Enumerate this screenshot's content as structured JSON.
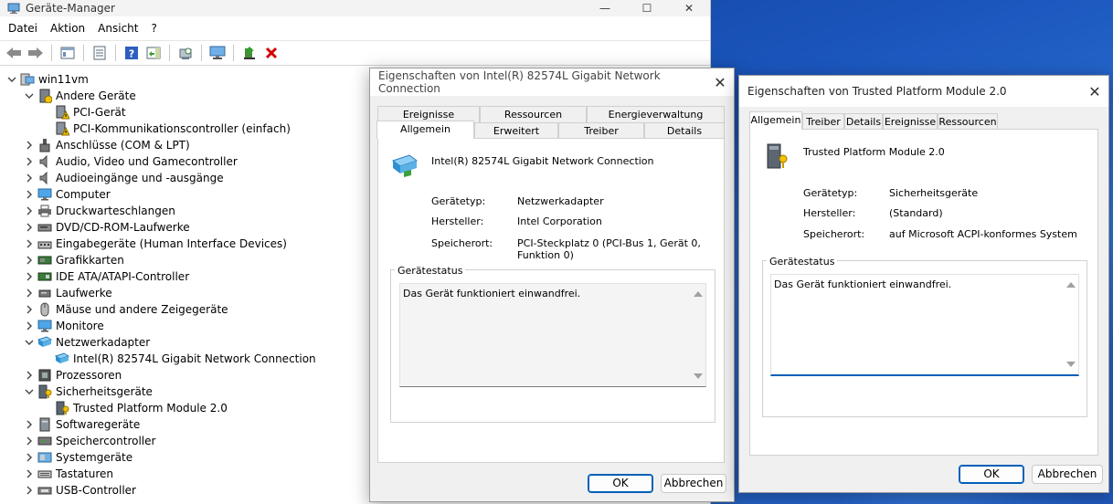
{
  "device_manager": {
    "title": "Geräte-Manager",
    "window_controls": {
      "minimize": "—",
      "maximize": "☐",
      "close": "✕"
    },
    "menu": [
      "Datei",
      "Aktion",
      "Ansicht",
      "?"
    ],
    "tree": [
      {
        "label": "win11vm",
        "level": 0,
        "expand": "v",
        "icon": "computer-icon"
      },
      {
        "label": "Andere Geräte",
        "level": 1,
        "expand": "v",
        "icon": "unknown-device-icon"
      },
      {
        "label": "PCI-Gerät",
        "level": 2,
        "expand": "",
        "icon": "warning-device-icon"
      },
      {
        "label": "PCI-Kommunikationscontroller (einfach)",
        "level": 2,
        "expand": "",
        "icon": "warning-device-icon"
      },
      {
        "label": "Anschlüsse (COM & LPT)",
        "level": 1,
        "expand": ">",
        "icon": "port-icon"
      },
      {
        "label": "Audio, Video und Gamecontroller",
        "level": 1,
        "expand": ">",
        "icon": "speaker-icon"
      },
      {
        "label": "Audioeingänge und -ausgänge",
        "level": 1,
        "expand": ">",
        "icon": "speaker-icon"
      },
      {
        "label": "Computer",
        "level": 1,
        "expand": ">",
        "icon": "monitor-icon"
      },
      {
        "label": "Druckwarteschlangen",
        "level": 1,
        "expand": ">",
        "icon": "printer-icon"
      },
      {
        "label": "DVD/CD-ROM-Laufwerke",
        "level": 1,
        "expand": ">",
        "icon": "dvd-drive-icon"
      },
      {
        "label": "Eingabegeräte (Human Interface Devices)",
        "level": 1,
        "expand": ">",
        "icon": "hid-icon"
      },
      {
        "label": "Grafikkarten",
        "level": 1,
        "expand": ">",
        "icon": "graphics-card-icon"
      },
      {
        "label": "IDE ATA/ATAPI-Controller",
        "level": 1,
        "expand": ">",
        "icon": "ide-controller-icon"
      },
      {
        "label": "Laufwerke",
        "level": 1,
        "expand": ">",
        "icon": "disk-drive-icon"
      },
      {
        "label": "Mäuse und andere Zeigegeräte",
        "level": 1,
        "expand": ">",
        "icon": "mouse-icon"
      },
      {
        "label": "Monitore",
        "level": 1,
        "expand": ">",
        "icon": "monitor-icon"
      },
      {
        "label": "Netzwerkadapter",
        "level": 1,
        "expand": "v",
        "icon": "network-adapter-icon"
      },
      {
        "label": "Intel(R) 82574L Gigabit Network Connection",
        "level": 2,
        "expand": "",
        "icon": "network-adapter-icon"
      },
      {
        "label": "Prozessoren",
        "level": 1,
        "expand": ">",
        "icon": "processor-icon"
      },
      {
        "label": "Sicherheitsgeräte",
        "level": 1,
        "expand": "v",
        "icon": "security-device-icon"
      },
      {
        "label": "Trusted Platform Module 2.0",
        "level": 2,
        "expand": "",
        "icon": "security-device-icon"
      },
      {
        "label": "Softwaregeräte",
        "level": 1,
        "expand": ">",
        "icon": "software-device-icon"
      },
      {
        "label": "Speichercontroller",
        "level": 1,
        "expand": ">",
        "icon": "storage-controller-icon"
      },
      {
        "label": "Systemgeräte",
        "level": 1,
        "expand": ">",
        "icon": "system-device-icon"
      },
      {
        "label": "Tastaturen",
        "level": 1,
        "expand": ">",
        "icon": "keyboard-icon"
      },
      {
        "label": "USB-Controller",
        "level": 1,
        "expand": ">",
        "icon": "usb-icon"
      }
    ]
  },
  "network_dialog": {
    "title": "Eigenschaften von Intel(R) 82574L Gigabit Network Connection",
    "close": "✕",
    "tabs_row1": [
      "Ereignisse",
      "Ressourcen",
      "Energieverwaltung"
    ],
    "tabs_row2": [
      "Allgemein",
      "Erweitert",
      "Treiber",
      "Details"
    ],
    "active_tab": "Allgemein",
    "device_name": "Intel(R) 82574L Gigabit Network Connection",
    "labels": {
      "type": "Gerätetyp:",
      "manufacturer": "Hersteller:",
      "location": "Speicherort:"
    },
    "values": {
      "type": "Netzwerkadapter",
      "manufacturer": "Intel Corporation",
      "location_line1": "PCI-Steckplatz 0 (PCI-Bus 1, Gerät 0,",
      "location_line2": "Funktion 0)"
    },
    "status_group": "Gerätestatus",
    "status_text": "Das Gerät funktioniert einwandfrei.",
    "ok": "OK",
    "cancel": "Abbrechen"
  },
  "tpm_dialog": {
    "title": "Eigenschaften von Trusted Platform Module 2.0",
    "close": "✕",
    "tabs": [
      "Allgemein",
      "Treiber",
      "Details",
      "Ereignisse",
      "Ressourcen"
    ],
    "active_tab": "Allgemein",
    "device_name": "Trusted Platform Module 2.0",
    "labels": {
      "type": "Gerätetyp:",
      "manufacturer": "Hersteller:",
      "location": "Speicherort:"
    },
    "values": {
      "type": "Sicherheitsgeräte",
      "manufacturer": "(Standard)",
      "location": "auf Microsoft ACPI-konformes System"
    },
    "status_group": "Gerätestatus",
    "status_text": "Das Gerät funktioniert einwandfrei.",
    "ok": "OK",
    "cancel": "Abbrechen"
  },
  "colors": {
    "accent": "#005fb8",
    "error_red": "#d40000",
    "warning_yellow": "#f2c200"
  }
}
